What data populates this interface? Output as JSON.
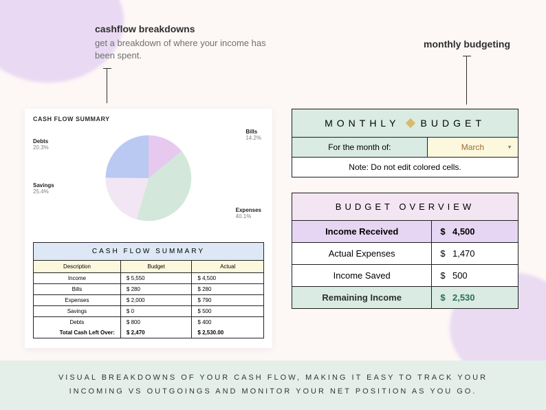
{
  "annotations": {
    "left": {
      "title": "cashflow breakdowns",
      "sub": "get a breakdown of where your income has been spent."
    },
    "right": {
      "title": "monthly budgeting"
    }
  },
  "cash_flow_panel": {
    "chart_title": "CASH FLOW SUMMARY",
    "table_title": "CASH FLOW SUMMARY",
    "headers": {
      "c1": "Description",
      "c2": "Budget",
      "c3": "Actual"
    },
    "rows": [
      {
        "desc": "Income",
        "budget": "$   5,550",
        "actual": "$   4,500"
      },
      {
        "desc": "Bills",
        "budget": "$   280",
        "actual": "$   280"
      },
      {
        "desc": "Expenses",
        "budget": "$   2,000",
        "actual": "$   790"
      },
      {
        "desc": "Savings",
        "budget": "$   0",
        "actual": "$   500"
      },
      {
        "desc": "Debts",
        "budget": "$   800",
        "actual": "$   400"
      }
    ],
    "total": {
      "label": "Total Cash Left Over:",
      "budget": "$   2,470",
      "actual": "$   2,530.00"
    }
  },
  "chart_data": {
    "type": "pie",
    "title": "CASH FLOW SUMMARY",
    "series": [
      {
        "name": "Bills",
        "pct": 14.2,
        "label": "14.2%",
        "color": "#e7c9ef"
      },
      {
        "name": "Expenses",
        "pct": 40.1,
        "label": "40.1%",
        "color": "#d3e8db"
      },
      {
        "name": "Savings",
        "pct": 25.4,
        "label": "25.4%",
        "color": "#f2e6f4"
      },
      {
        "name": "Debts",
        "pct": 20.3,
        "label": "20.3%",
        "color": "#b9c9f2"
      }
    ]
  },
  "monthly_budget": {
    "title_left": "MONTHLY",
    "title_right": "BUDGET",
    "month_label": "For the month of:",
    "month_value": "March",
    "note": "Note: Do not edit colored cells."
  },
  "budget_overview": {
    "title": "BUDGET OVERVIEW",
    "rows": [
      {
        "label": "Income Received",
        "value": "4,500",
        "highlight": "purple"
      },
      {
        "label": "Actual Expenses",
        "value": "1,470",
        "highlight": ""
      },
      {
        "label": "Income Saved",
        "value": "500",
        "highlight": ""
      },
      {
        "label": "Remaining Income",
        "value": "2,530",
        "highlight": "mint"
      }
    ]
  },
  "footer": "VISUAL BREAKDOWNS OF YOUR CASH FLOW, MAKING IT EASY TO TRACK YOUR INCOMING VS OUTGOINGS AND MONITOR YOUR NET POSITION AS YOU GO."
}
